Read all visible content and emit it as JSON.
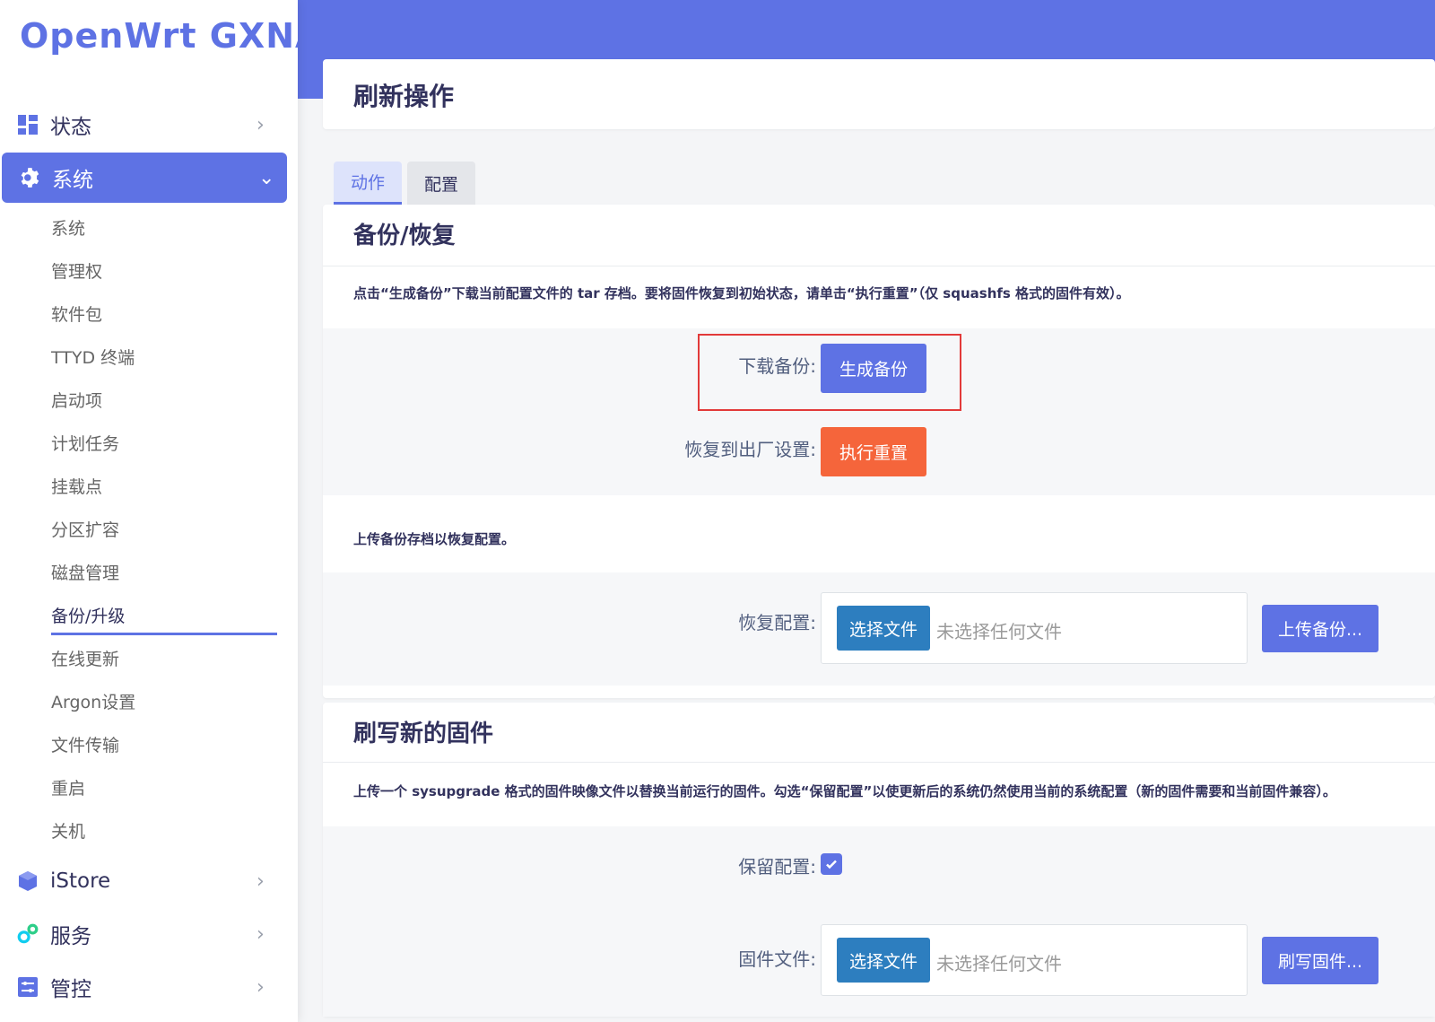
{
  "brand": "OpenWrt GXNAS",
  "sidebar": {
    "main_items": [
      {
        "label": "状态",
        "icon": "dashboard-icon"
      },
      {
        "label": "系统",
        "icon": "gear-icon"
      },
      {
        "label": "iStore",
        "icon": "cube-icon"
      },
      {
        "label": "服务",
        "icon": "gears-icon"
      },
      {
        "label": "管控",
        "icon": "sliders-icon"
      }
    ],
    "sub_items": [
      "系统",
      "管理权",
      "软件包",
      "TTYD 终端",
      "启动项",
      "计划任务",
      "挂载点",
      "分区扩容",
      "磁盘管理",
      "备份/升级",
      "在线更新",
      "Argon设置",
      "文件传输",
      "重启",
      "关机"
    ],
    "current_sub": "备份/升级"
  },
  "page": {
    "title": "刷新操作",
    "tabs": [
      "动作",
      "配置"
    ],
    "backup": {
      "title": "备份/恢复",
      "desc": "点击“生成备份”下载当前配置文件的 tar 存档。要将固件恢复到初始状态，请单击“执行重置”（仅 squashfs 格式的固件有效）。",
      "download_label": "下载备份:",
      "generate_btn": "生成备份",
      "reset_label": "恢复到出厂设置:",
      "reset_btn": "执行重置",
      "upload_desc": "上传备份存档以恢复配置。",
      "restore_label": "恢复配置:",
      "choose_file": "选择文件",
      "no_file": "未选择任何文件",
      "upload_btn": "上传备份..."
    },
    "flash": {
      "title": "刷写新的固件",
      "desc": "上传一个 sysupgrade 格式的固件映像文件以替换当前运行的固件。勾选“保留配置”以使更新后的系统仍然使用当前的系统配置（新的固件需要和当前固件兼容）。",
      "keep_label": "保留配置:",
      "keep_checked": true,
      "firmware_label": "固件文件:",
      "choose_file": "选择文件",
      "no_file": "未选择任何文件",
      "flash_btn": "刷写固件..."
    }
  }
}
